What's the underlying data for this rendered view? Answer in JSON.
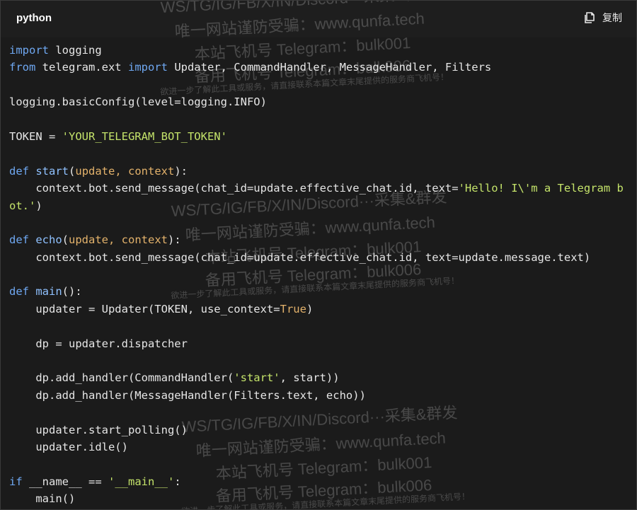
{
  "header": {
    "language": "python",
    "copy_label": "复制",
    "copy_icon": "copy-icon"
  },
  "colors": {
    "background": "#1b1b1b",
    "keyword": "#6fa8f2",
    "function": "#8fc1ff",
    "param": "#e3b26b",
    "string": "#c4e36a",
    "text": "#e6e6e6"
  },
  "code_lines": [
    [
      {
        "t": "import",
        "c": "kw"
      },
      {
        "t": " logging"
      }
    ],
    [
      {
        "t": "from",
        "c": "kw"
      },
      {
        "t": " telegram.ext "
      },
      {
        "t": "import",
        "c": "kw"
      },
      {
        "t": " Updater, CommandHandler, MessageHandler, Filters"
      }
    ],
    [],
    [
      {
        "t": "logging.basicConfig(level=logging.INFO)"
      }
    ],
    [],
    [
      {
        "t": "TOKEN = "
      },
      {
        "t": "'YOUR_TELEGRAM_BOT_TOKEN'",
        "c": "str"
      }
    ],
    [],
    [
      {
        "t": "def",
        "c": "kw"
      },
      {
        "t": " "
      },
      {
        "t": "start",
        "c": "fn"
      },
      {
        "t": "("
      },
      {
        "t": "update, context",
        "c": "param"
      },
      {
        "t": "):"
      }
    ],
    [
      {
        "t": "    context.bot.send_message(chat_id=update.effective_chat.id, text="
      },
      {
        "t": "'Hello! I\\'m a Telegram b",
        "c": "str"
      }
    ],
    [
      {
        "t": "ot.'",
        "c": "str"
      },
      {
        "t": ")"
      }
    ],
    [],
    [
      {
        "t": "def",
        "c": "kw"
      },
      {
        "t": " "
      },
      {
        "t": "echo",
        "c": "fn"
      },
      {
        "t": "("
      },
      {
        "t": "update, context",
        "c": "param"
      },
      {
        "t": "):"
      }
    ],
    [
      {
        "t": "    context.bot.send_message(chat_id=update.effective_chat.id, text=update.message.text)"
      }
    ],
    [],
    [
      {
        "t": "def",
        "c": "kw"
      },
      {
        "t": " "
      },
      {
        "t": "main",
        "c": "fn"
      },
      {
        "t": "():"
      }
    ],
    [
      {
        "t": "    updater = Updater(TOKEN, use_context="
      },
      {
        "t": "True",
        "c": "const"
      },
      {
        "t": ")"
      }
    ],
    [],
    [
      {
        "t": "    dp = updater.dispatcher"
      }
    ],
    [],
    [
      {
        "t": "    dp.add_handler(CommandHandler("
      },
      {
        "t": "'start'",
        "c": "str"
      },
      {
        "t": ", start))"
      }
    ],
    [
      {
        "t": "    dp.add_handler(MessageHandler(Filters.text, echo))"
      }
    ],
    [],
    [
      {
        "t": "    updater.start_polling()"
      }
    ],
    [
      {
        "t": "    updater.idle()"
      }
    ],
    [],
    [
      {
        "t": "if",
        "c": "kw"
      },
      {
        "t": " __name__ == "
      },
      {
        "t": "'__main__'",
        "c": "str"
      },
      {
        "t": ":"
      }
    ],
    [
      {
        "t": "    main()"
      }
    ]
  ],
  "watermarks": [
    {
      "text": "WS/TG/IG/FB/X/IN/Discord···采集&群发",
      "size": "lg",
      "pos": "top-center"
    },
    {
      "text": "唯一网站谨防受骗：www.qunfa.tech",
      "size": "lg",
      "pos": "top-center"
    },
    {
      "text": "本站飞机号 Telegram：bulk001",
      "size": "lg",
      "pos": "top-center"
    },
    {
      "text": "备用飞机号 Telegram：bulk006",
      "size": "lg",
      "pos": "top-center"
    },
    {
      "text": "欲进一步了解此工具或服务，请直接联系本篇文章末尾提供的服务商飞机号！",
      "size": "sm",
      "pos": "top-center"
    },
    {
      "text": "WS/TG/IG/FB/X/IN/Discord···采集&群发",
      "size": "lg",
      "pos": "mid-center"
    },
    {
      "text": "唯一网站谨防受骗：www.qunfa.tech",
      "size": "lg",
      "pos": "mid-center"
    },
    {
      "text": "本站飞机号 Telegram：bulk001",
      "size": "lg",
      "pos": "mid-center"
    },
    {
      "text": "备用飞机号 Telegram：bulk006",
      "size": "lg",
      "pos": "mid-center"
    },
    {
      "text": "欲进一步了解此工具或服务，请直接联系本篇文章末尾提供的服务商飞机号！",
      "size": "sm",
      "pos": "mid-center"
    },
    {
      "text": "WS/TG/IG/FB/X/IN/Discord···采集&群发",
      "size": "lg",
      "pos": "bottom-center"
    },
    {
      "text": "唯一网站谨防受骗：www.qunfa.tech",
      "size": "lg",
      "pos": "bottom-center"
    },
    {
      "text": "本站飞机号 Telegram：bulk001",
      "size": "lg",
      "pos": "bottom-center"
    },
    {
      "text": "备用飞机号 Telegram：bulk006",
      "size": "lg",
      "pos": "bottom-center"
    },
    {
      "text": "欲进一步了解此工具或服务，请直接联系本篇文章末尾提供的服务商飞机号！",
      "size": "sm",
      "pos": "bottom-center"
    }
  ]
}
